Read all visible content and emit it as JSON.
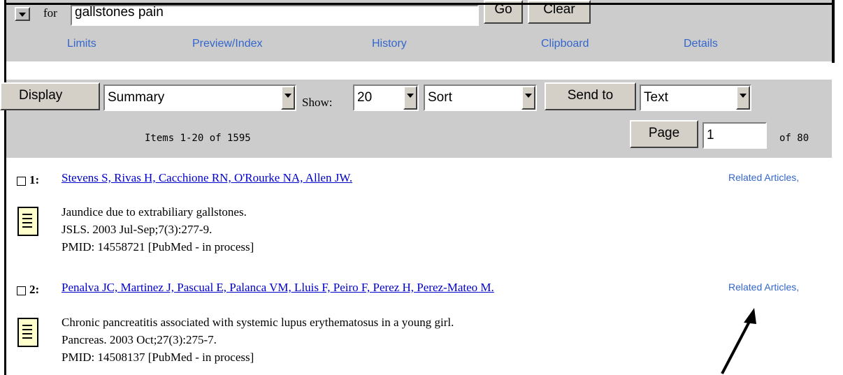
{
  "search": {
    "for_label": "for",
    "query": "gallstones pain",
    "go_label": "Go",
    "clear_label": "Clear"
  },
  "nav": [
    "Limits",
    "Preview/Index",
    "History",
    "Clipboard",
    "Details"
  ],
  "toolbar": {
    "display_label": "Display",
    "format_selected": "Summary",
    "show_label": "Show:",
    "show_selected": "20",
    "sort_selected": "Sort",
    "send_to_label": "Send to",
    "send_to_selected": "Text",
    "items_text": "Items 1-20 of 1595",
    "page_label": "Page",
    "page_value": "1",
    "page_total_text": "of 80"
  },
  "results": [
    {
      "number": "1:",
      "authors": "Stevens S, Rivas H, Cacchione RN, O'Rourke NA, Allen JW.",
      "related": "Related Articles,",
      "title": "Jaundice due to extrabiliary gallstones.",
      "citation": "JSLS. 2003 Jul-Sep;7(3):277-9.",
      "pmid": "PMID: 14558721 [PubMed - in process]"
    },
    {
      "number": "2:",
      "authors": "Penalva JC, Martinez J, Pascual E, Palanca VM, Lluis F, Peiro F, Perez H, Perez-Mateo M.",
      "related": "Related Articles,",
      "title": "Chronic pancreatitis associated with systemic lupus erythematosus in a young girl.",
      "citation": "Pancreas. 2003 Oct;27(3):275-7.",
      "pmid": "PMID: 14508137 [PubMed - in process]"
    }
  ],
  "icons": [
    "dropdown-arrow-icon",
    "document-icon",
    "checkbox-icon",
    "pointer-arrow-icon"
  ],
  "colors": {
    "band": "#cccccc",
    "link": "#0000cc",
    "nav_link": "#3366cc",
    "doc_icon": "#ffffcc"
  }
}
